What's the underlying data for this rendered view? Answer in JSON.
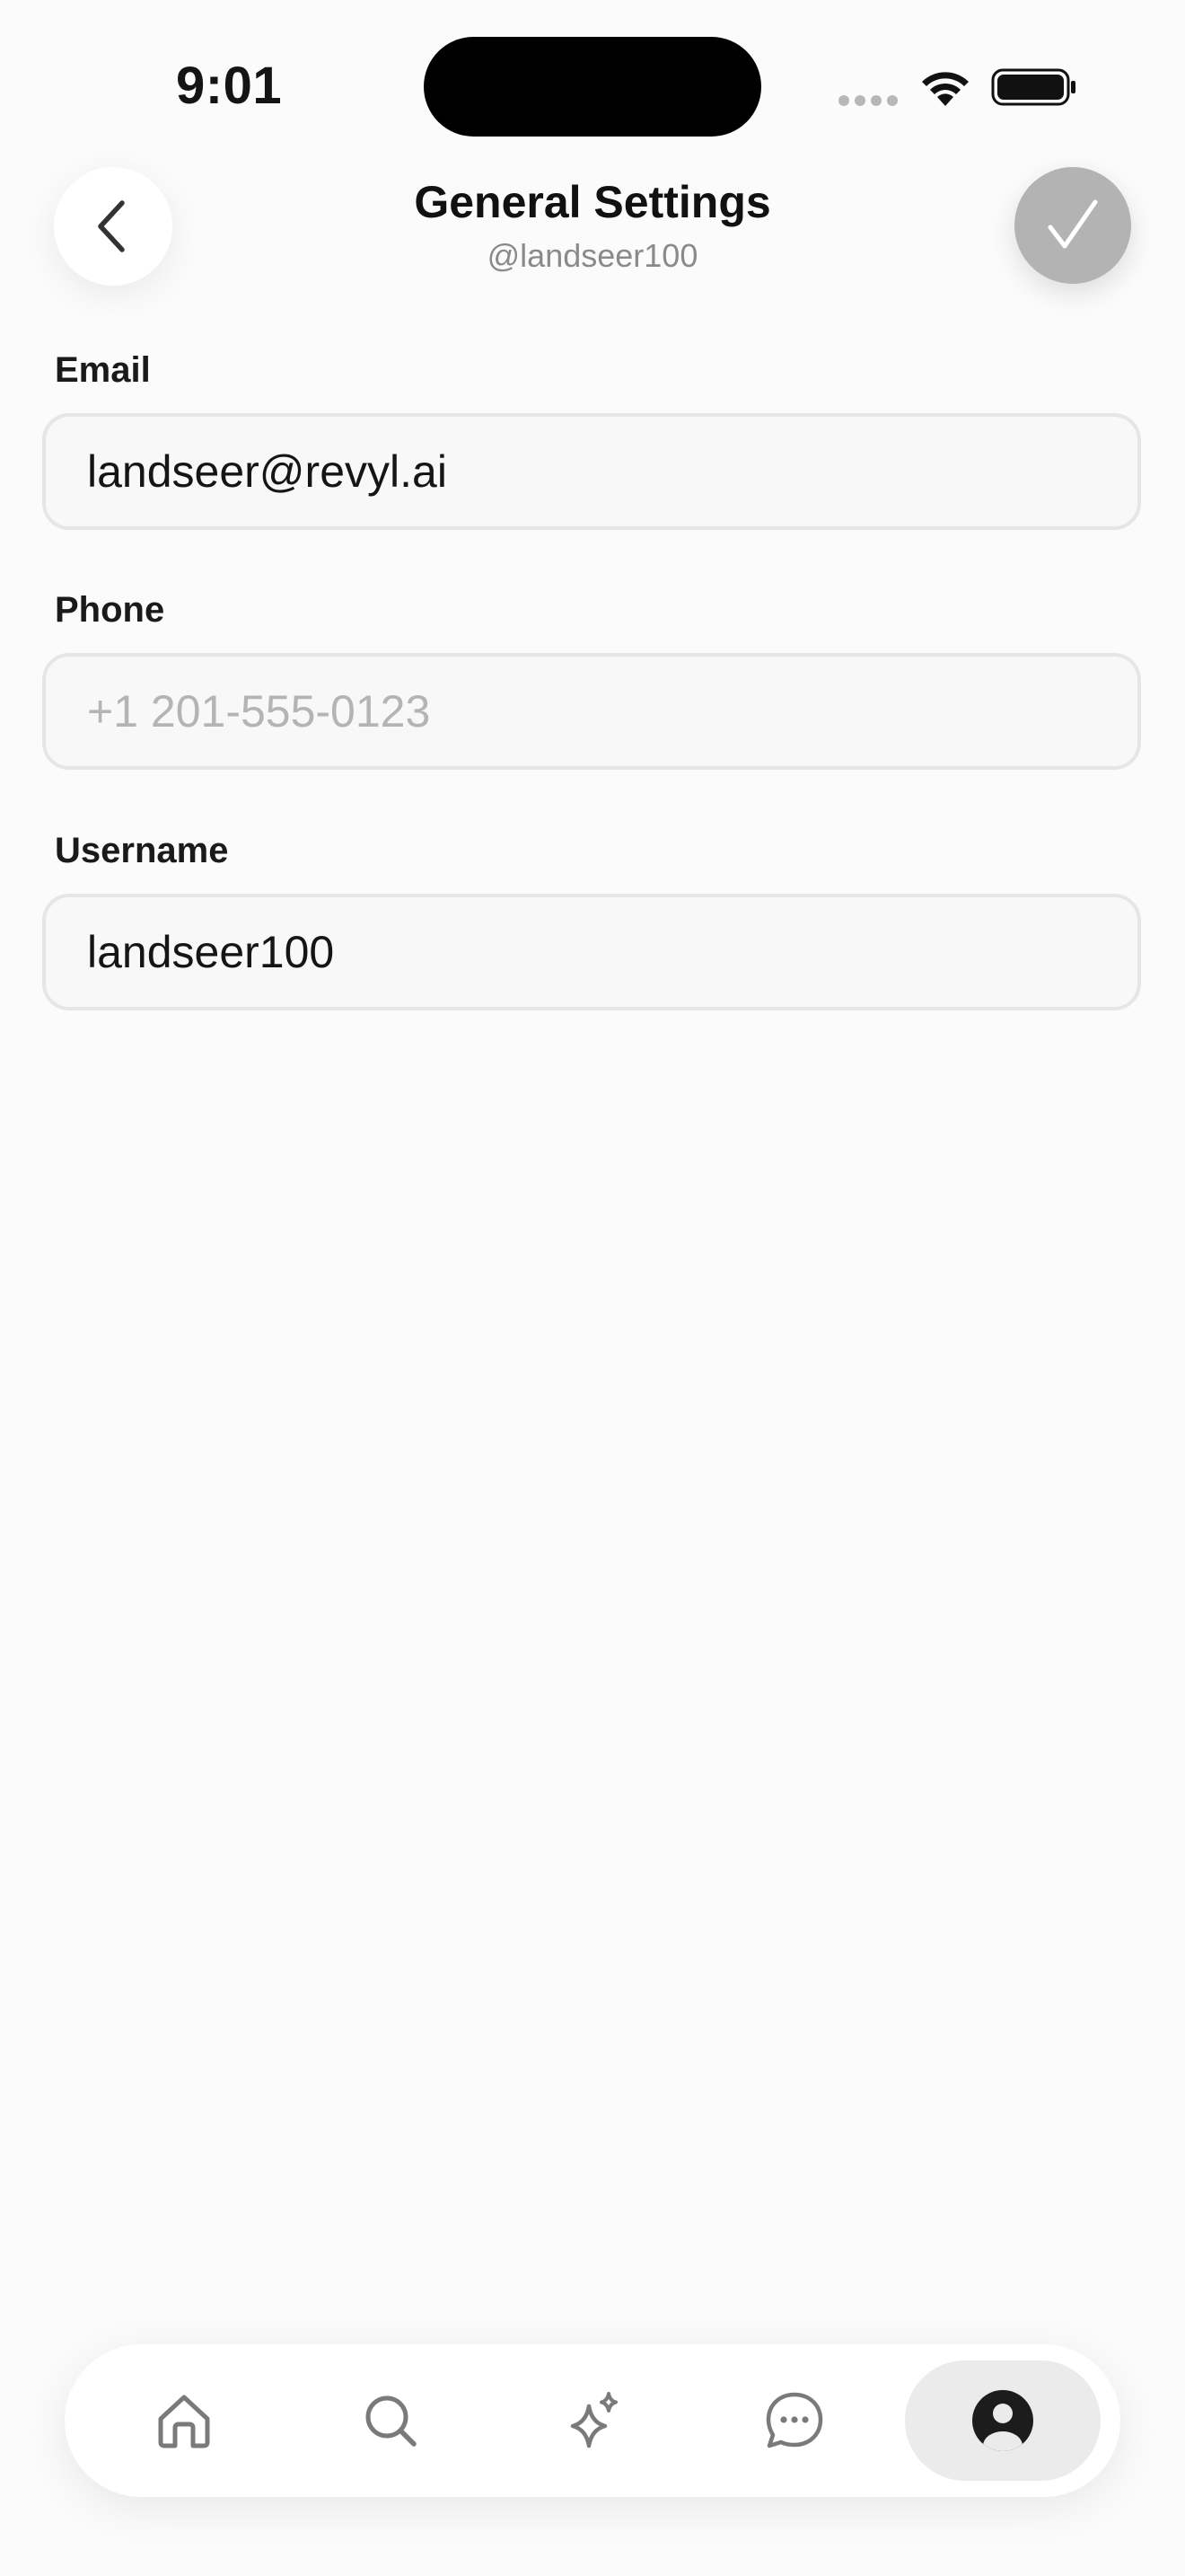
{
  "status_bar": {
    "time": "9:01"
  },
  "header": {
    "title": "General Settings",
    "subtitle": "@landseer100",
    "back_icon": "chevron-left-icon",
    "confirm_icon": "checkmark-icon",
    "confirm_color": "#b3b3b3"
  },
  "form": {
    "email": {
      "label": "Email",
      "value": "landseer@revyl.ai",
      "placeholder": ""
    },
    "phone": {
      "label": "Phone",
      "value": "",
      "placeholder": "+1 201-555-0123"
    },
    "username": {
      "label": "Username",
      "value": "landseer100",
      "placeholder": ""
    }
  },
  "tab_bar": {
    "tabs": [
      {
        "icon": "home-icon",
        "active": false
      },
      {
        "icon": "search-icon",
        "active": false
      },
      {
        "icon": "sparkle-icon",
        "active": false
      },
      {
        "icon": "chat-bubble-icon",
        "active": false
      },
      {
        "icon": "profile-icon",
        "active": true
      }
    ]
  }
}
